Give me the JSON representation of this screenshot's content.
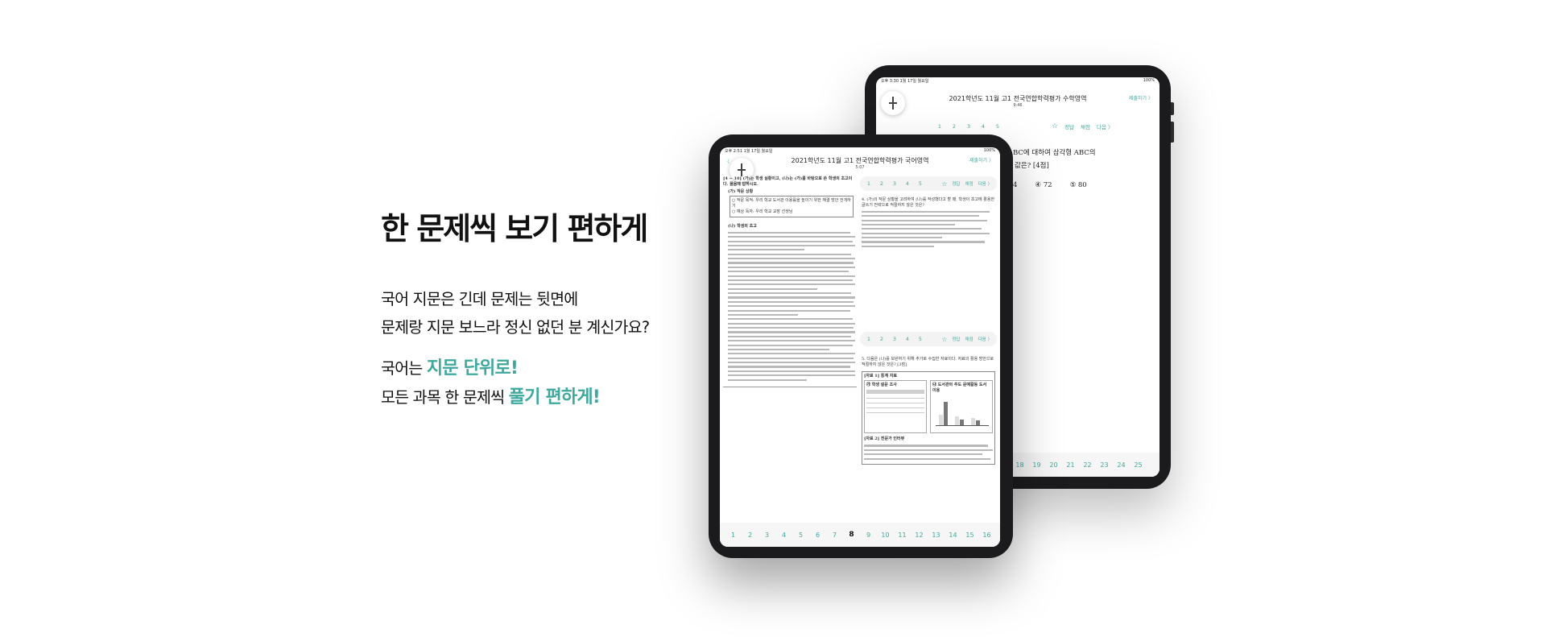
{
  "headline": "한 문제씩 보기 편하게",
  "lead": {
    "line1": "국어 지문은 긴데 문제는 뒷면에",
    "line2": "문제랑 지문 보느라 정신 없던 분 계신가요?"
  },
  "promo": {
    "line1_prefix": "국어는 ",
    "line1_accent": "지문 단위로!",
    "line2_prefix": "모든 과목 한 문제씩 ",
    "line2_accent": "풀기 편하게!"
  },
  "colors": {
    "accent": "#3fa89d",
    "device": "#1b1b1d"
  },
  "back_tablet": {
    "status_time": "오후 3:30",
    "status_date": "1월 17일 월요일",
    "status_right": "100%",
    "title": "2021학년도 11월 고1 전국연합학력평가 수학영역",
    "timer": "9:46",
    "submit": "제출하기 〉",
    "question_numbers": [
      "1",
      "2",
      "3",
      "4",
      "5"
    ],
    "tools": {
      "star": "☆",
      "hint": "정답",
      "score": "채점",
      "next": "다음 〉"
    },
    "question_line1": "BC에 대하여 삼각형 ABC의",
    "question_line2": "값은? [4점]",
    "choice_prev": "4",
    "choice4": "④ 72",
    "choice5": "⑤ 80",
    "bottom_numbers": [
      "18",
      "19",
      "20",
      "21",
      "22",
      "23",
      "24",
      "25"
    ]
  },
  "front_tablet": {
    "status_time": "오후 2:51",
    "status_date": "1월 17일 월요일",
    "status_right": "100%",
    "title": "2021학년도 11월 고1 전국연합학력평가 국어영역",
    "timer": "5:07",
    "back_link": "〈",
    "submit": "제출하기 〉",
    "passage_header": "[4 ~ 10] (가)는 학생 실황이고, (나)는 (가)를 바탕으로 쓴 학생의 초고이다. 물음에 답하시오.",
    "passage_sub": "(가) 작문 상황",
    "passage_box1": "○ 작문 목적: 우리 학교 도서관 이용률을 높이기 위한 해결 방안 전개하기",
    "passage_box2": "○ 예상 독자: 우리 학교 교장 선생님",
    "passage_draft": "(나) 학생의 초고",
    "question_numbers": [
      "1",
      "2",
      "3",
      "4",
      "5"
    ],
    "tools": {
      "star": "☆",
      "hint": "정답",
      "score": "채점",
      "next": "다음 〉"
    },
    "question_a_header": "4. (가)의 작문 상황을 고려하여 (나)를 작성했다고 할 때, 학생이 초고에 활용한 글쓰기 전략으로 적절하지 않은 것은?",
    "question_b_header": "5. 다음은 (나)를 보완하기 위해 추가로 수집한 자료이다. 자료의 활용 방안으로 적절하지 않은 것은? [3점]",
    "material1_title": "[자료 1] 통계 자료",
    "material1_a": "㉮ 학생 설문 조사",
    "material1_b": "㉯ 도서관의 주도 문예활동 도서 이용",
    "material2_title": "[자료 2] 전문가 인터뷰",
    "bottom_numbers": [
      "1",
      "2",
      "3",
      "4",
      "5",
      "6",
      "7",
      "8",
      "9",
      "10",
      "11",
      "12",
      "13",
      "14",
      "15",
      "16"
    ],
    "bottom_current": "8"
  }
}
